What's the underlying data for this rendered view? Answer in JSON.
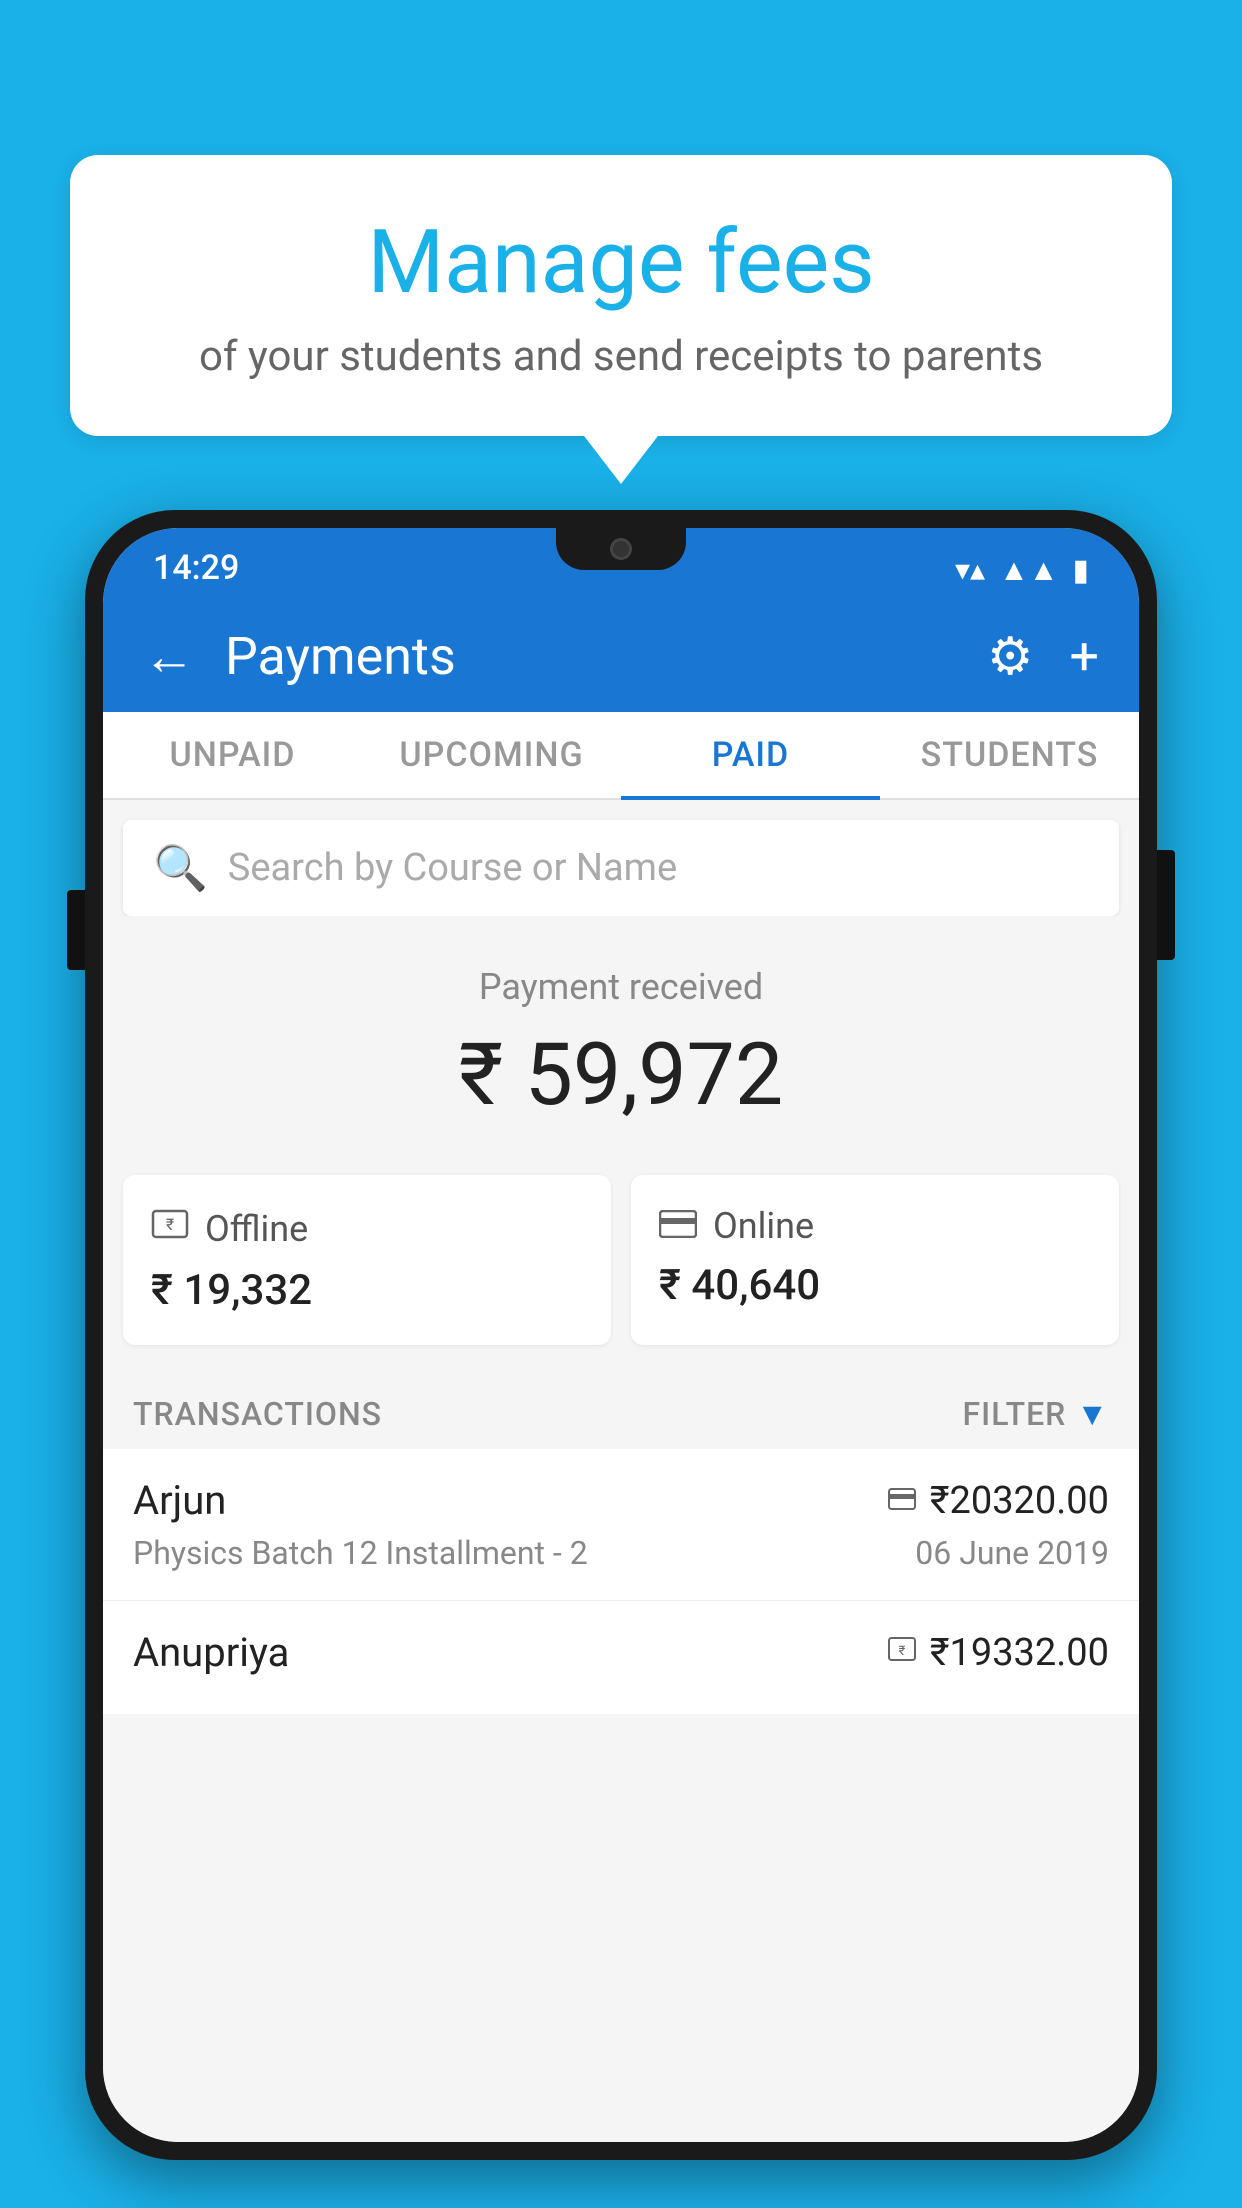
{
  "background_color": "#1ab0e8",
  "speech_bubble": {
    "title": "Manage fees",
    "subtitle": "of your students and send receipts to parents"
  },
  "status_bar": {
    "time": "14:29",
    "wifi_symbol": "▲",
    "signal_symbol": "▲",
    "battery_symbol": "▮"
  },
  "app_bar": {
    "title": "Payments",
    "back_label": "←",
    "gear_label": "⚙",
    "plus_label": "+"
  },
  "tabs": [
    {
      "id": "unpaid",
      "label": "UNPAID",
      "active": false
    },
    {
      "id": "upcoming",
      "label": "UPCOMING",
      "active": false
    },
    {
      "id": "paid",
      "label": "PAID",
      "active": true
    },
    {
      "id": "students",
      "label": "STUDENTS",
      "active": false
    }
  ],
  "search": {
    "placeholder": "Search by Course or Name"
  },
  "payment_summary": {
    "label": "Payment received",
    "amount": "₹ 59,972"
  },
  "payment_cards": [
    {
      "id": "offline",
      "label": "Offline",
      "amount": "₹ 19,332",
      "icon": "offline"
    },
    {
      "id": "online",
      "label": "Online",
      "amount": "₹ 40,640",
      "icon": "online"
    }
  ],
  "transactions_header": {
    "label": "TRANSACTIONS",
    "filter_label": "FILTER"
  },
  "transactions": [
    {
      "name": "Arjun",
      "course": "Physics Batch 12 Installment - 2",
      "amount": "₹20320.00",
      "date": "06 June 2019",
      "payment_type": "online"
    },
    {
      "name": "Anupriya",
      "course": "",
      "amount": "₹19332.00",
      "date": "",
      "payment_type": "offline"
    }
  ]
}
